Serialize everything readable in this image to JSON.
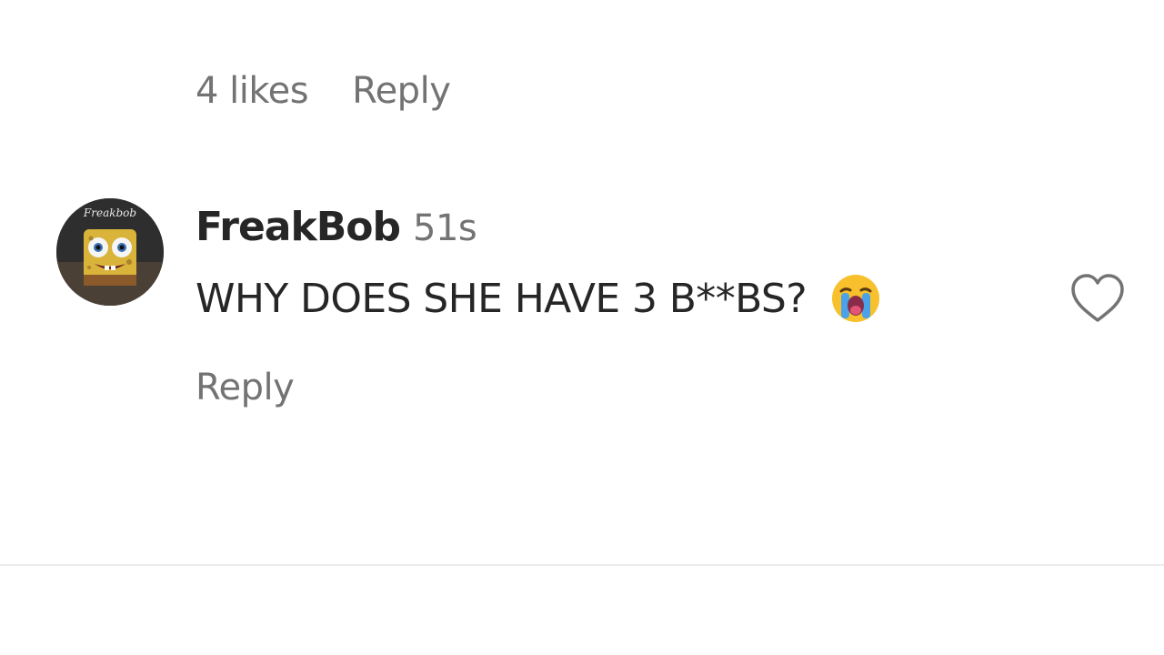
{
  "previous_comment": {
    "likes": "4 likes",
    "reply_label": "Reply"
  },
  "comment": {
    "username": "FreakBob",
    "timestamp": "51s",
    "text": "WHY DOES SHE HAVE 3 B**BS?",
    "emoji": "loudly-crying-face",
    "reply_label": "Reply",
    "like_icon": "heart-outline-icon",
    "avatar_caption": "FreakBob"
  },
  "colors": {
    "primary_text": "#262626",
    "secondary_text": "#737373",
    "divider": "#ececec",
    "background": "#ffffff"
  }
}
